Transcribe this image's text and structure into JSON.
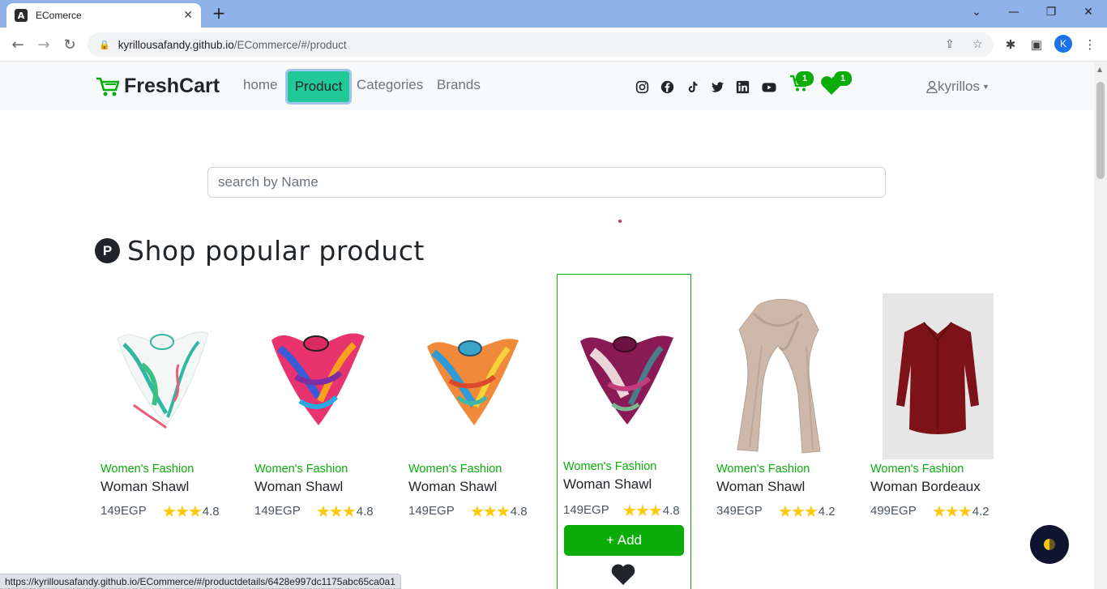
{
  "browser": {
    "tab_title": "EComerce",
    "url_domain": "kyrillousafandy.github.io",
    "url_path": "/ECommerce/#/product",
    "profile_initial": "K"
  },
  "navbar": {
    "logo_text": "FreshCart",
    "links": [
      "home",
      "Product",
      "Categories",
      "Brands"
    ],
    "active_link": "Product",
    "cart_count": "1",
    "wishlist_count": "1",
    "user_name": "kyrillos"
  },
  "search": {
    "placeholder": "search by Name"
  },
  "section": {
    "badge": "P",
    "title": "Shop popular product"
  },
  "products": [
    {
      "category": "Women's Fashion",
      "name": "Woman Shawl",
      "price": "149EGP",
      "rating": "4.8"
    },
    {
      "category": "Women's Fashion",
      "name": "Woman Shawl",
      "price": "149EGP",
      "rating": "4.8"
    },
    {
      "category": "Women's Fashion",
      "name": "Woman Shawl",
      "price": "149EGP",
      "rating": "4.8"
    },
    {
      "category": "Women's Fashion",
      "name": "Woman Shawl",
      "price": "149EGP",
      "rating": "4.8",
      "add_label": "+ Add"
    },
    {
      "category": "Women's Fashion",
      "name": "Woman Shawl",
      "price": "349EGP",
      "rating": "4.2"
    },
    {
      "category": "Women's Fashion",
      "name": "Woman Bordeaux",
      "price": "499EGP",
      "rating": "4.2"
    }
  ],
  "status_url": "https://kyrillousafandy.github.io/ECommerce/#/productdetails/6428e997dc1175abc65ca0a1",
  "colors": {
    "brand_green": "#0aad0a",
    "active_nav": "#20c997",
    "star": "#ffc908"
  }
}
